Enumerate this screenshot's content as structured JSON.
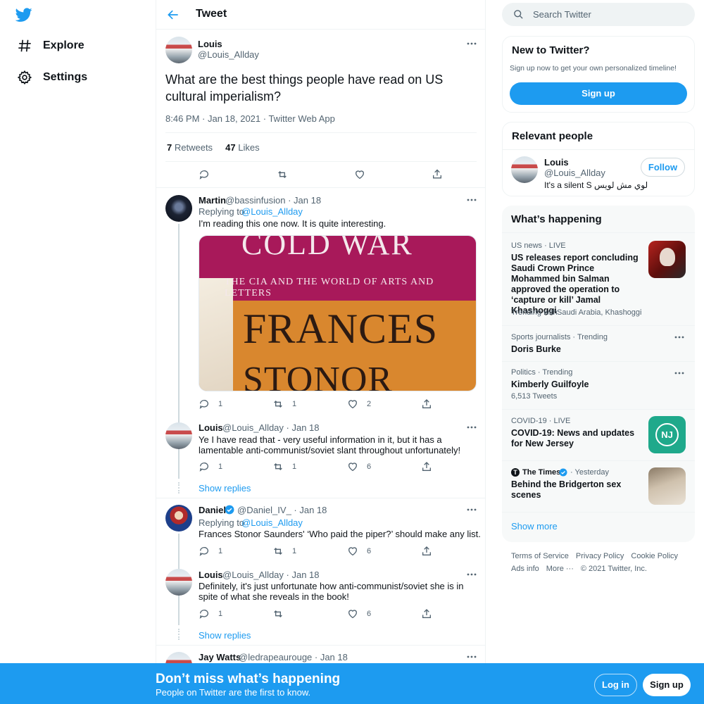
{
  "nav": {
    "logo": "twitter-bird-icon",
    "items": [
      {
        "label": "Explore",
        "icon": "hashtag-icon"
      },
      {
        "label": "Settings",
        "icon": "gear-icon"
      }
    ]
  },
  "header": {
    "title": "Tweet"
  },
  "main_tweet": {
    "name": "Louis",
    "handle": "@Louis_Allday",
    "text": "What are the best things people have read on US cultural imperialism?",
    "meta": "8:46 PM · Jan 18, 2021 · Twitter Web App",
    "retweets_count": "7",
    "retweets_label": "Retweets",
    "likes_count": "47",
    "likes_label": "Likes"
  },
  "replies": [
    {
      "name": "Martin",
      "handle_date": "@bassinfusion · Jan 18",
      "replying_prefix": "Replying to",
      "replying_to": "@Louis_Allday",
      "text": "I'm reading this one now. It is quite interesting.",
      "book": {
        "line1": "COLD WAR",
        "line2": "THE CIA AND THE WORLD OF ARTS AND LETTERS",
        "line3": "FRANCES",
        "line4": "STONOR"
      },
      "replies": "1",
      "retweets": "1",
      "likes": "2"
    },
    {
      "name": "Louis",
      "handle_date": "@Louis_Allday · Jan 18",
      "text": "Ye I have read that - very useful information in it, but it has a lamentable anti-communist/soviet slant throughout unfortunately!",
      "replies": "1",
      "retweets": "1",
      "likes": "6",
      "show_replies": "Show replies"
    },
    {
      "name": "Daniel",
      "handle_date": "@Daniel_IV_ · Jan 18",
      "replying_prefix": "Replying to",
      "replying_to": "@Louis_Allday",
      "text": "Frances Stonor Saunders' ‘Who paid the piper?’ should make any list.",
      "replies": "1",
      "retweets": "1",
      "likes": "6"
    },
    {
      "name": "Louis",
      "handle_date": "@Louis_Allday · Jan 18",
      "text": "Definitely, it's just unfortunate how anti-communist/soviet she is in spite of what she reveals in the book!",
      "replies": "1",
      "retweets": "",
      "likes": "6",
      "show_replies": "Show replies"
    },
    {
      "name": "Jay Watts",
      "handle_date": "@ledrapeaurouge · Jan 18"
    }
  ],
  "search": {
    "placeholder": "Search Twitter"
  },
  "new_to_twitter": {
    "title": "New to Twitter?",
    "subtitle": "Sign up now to get your own personalized timeline!",
    "button": "Sign up"
  },
  "relevant": {
    "title": "Relevant people",
    "name": "Louis",
    "handle": "@Louis_Allday",
    "bio": "It's a silent S لوي مش لويس",
    "follow": "Follow"
  },
  "happening": {
    "title": "What’s happening",
    "trends": [
      {
        "category": "US news · LIVE",
        "title": "US releases report concluding Saudi Crown Prince Mohammed bin Salman approved the operation to ‘capture or kill’ Jamal Khashoggi",
        "trending_with_label": "Trending with",
        "trending_with": "Saudi Arabia, Khashoggi"
      },
      {
        "category": "Sports journalists · Trending",
        "title": "Doris Burke"
      },
      {
        "category": "Politics · Trending",
        "title": "Kimberly Guilfoyle",
        "sub": "6,513 Tweets"
      },
      {
        "category": "COVID-19 · LIVE",
        "title": "COVID-19: News and updates for New Jersey",
        "badge": "NJ"
      },
      {
        "source": "The Times",
        "date": "· Yesterday",
        "title": "Behind the Bridgerton sex scenes"
      }
    ],
    "show_more": "Show more"
  },
  "footer": {
    "links": [
      "Terms of Service",
      "Privacy Policy",
      "Cookie Policy",
      "Ads info",
      "More ···"
    ],
    "copyright": "© 2021 Twitter, Inc."
  },
  "bottom_bar": {
    "headline": "Don’t miss what’s happening",
    "subline": "People on Twitter are the first to know.",
    "login": "Log in",
    "signup": "Sign up"
  },
  "colors": {
    "accent": "#1d9bf0",
    "text": "#0f1419",
    "muted": "#536471"
  }
}
